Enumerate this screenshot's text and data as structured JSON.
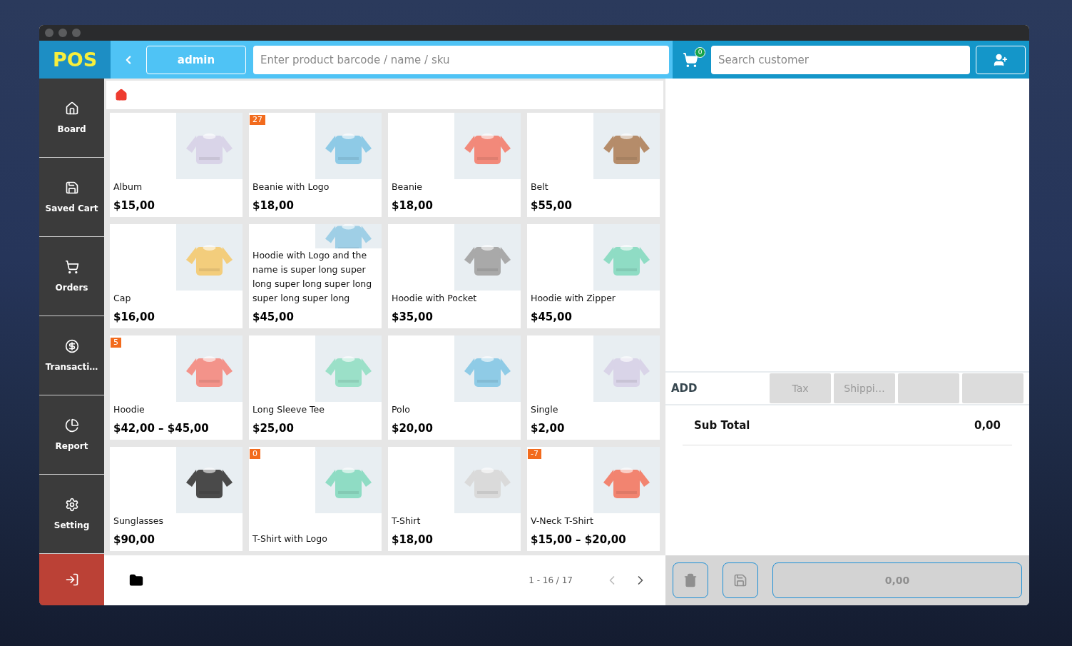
{
  "header": {
    "logo": "POS",
    "user": "admin",
    "product_search": {
      "placeholder": "Enter product barcode / name / sku"
    },
    "cart_count": "0",
    "customer_search": {
      "placeholder": "Search customer"
    }
  },
  "sidebar": {
    "items": [
      {
        "label": "Board"
      },
      {
        "label": "Saved Cart"
      },
      {
        "label": "Orders"
      },
      {
        "label": "Transacti…"
      },
      {
        "label": "Report"
      },
      {
        "label": "Setting"
      }
    ]
  },
  "products": [
    {
      "name": "Album",
      "price": "$15,00"
    },
    {
      "name": "Beanie with Logo",
      "price": "$18,00",
      "badge": "27"
    },
    {
      "name": "Beanie",
      "price": "$18,00"
    },
    {
      "name": "Belt",
      "price": "$55,00"
    },
    {
      "name": "Cap",
      "price": "$16,00"
    },
    {
      "name": "Hoodie with Logo and the name is super long super long super long super long super long super long",
      "price": "$45,00"
    },
    {
      "name": "Hoodie with Pocket",
      "price": "$35,00"
    },
    {
      "name": "Hoodie with Zipper",
      "price": "$45,00"
    },
    {
      "name": "Hoodie",
      "price": "$42,00 – $45,00",
      "badge": "5"
    },
    {
      "name": "Long Sleeve Tee",
      "price": "$25,00"
    },
    {
      "name": "Polo",
      "price": "$20,00"
    },
    {
      "name": "Single",
      "price": "$2,00"
    },
    {
      "name": "Sunglasses",
      "price": "$90,00"
    },
    {
      "name": "T-Shirt with Logo",
      "badge": "0"
    },
    {
      "name": "T-Shirt",
      "price": "$18,00"
    },
    {
      "name": "V-Neck T-Shirt",
      "price": "$15,00 – $20,00",
      "badge": "-7"
    }
  ],
  "pagination": {
    "range": "1 - 16 / 17",
    "prev": {
      "disabled": true
    },
    "next": {
      "disabled": false
    }
  },
  "cart": {
    "add_label": "ADD",
    "add_buttons": [
      {
        "label": "Tax",
        "disabled": true
      },
      {
        "label": "Shippi…",
        "disabled": true
      },
      {
        "disabled": true
      },
      {
        "disabled": true
      }
    ],
    "subtotal": {
      "label": "Sub Total",
      "value": "0,00"
    },
    "delete": {
      "disabled": true
    },
    "save": {
      "disabled": true
    },
    "total": {
      "label": "0,00",
      "disabled": true
    }
  }
}
